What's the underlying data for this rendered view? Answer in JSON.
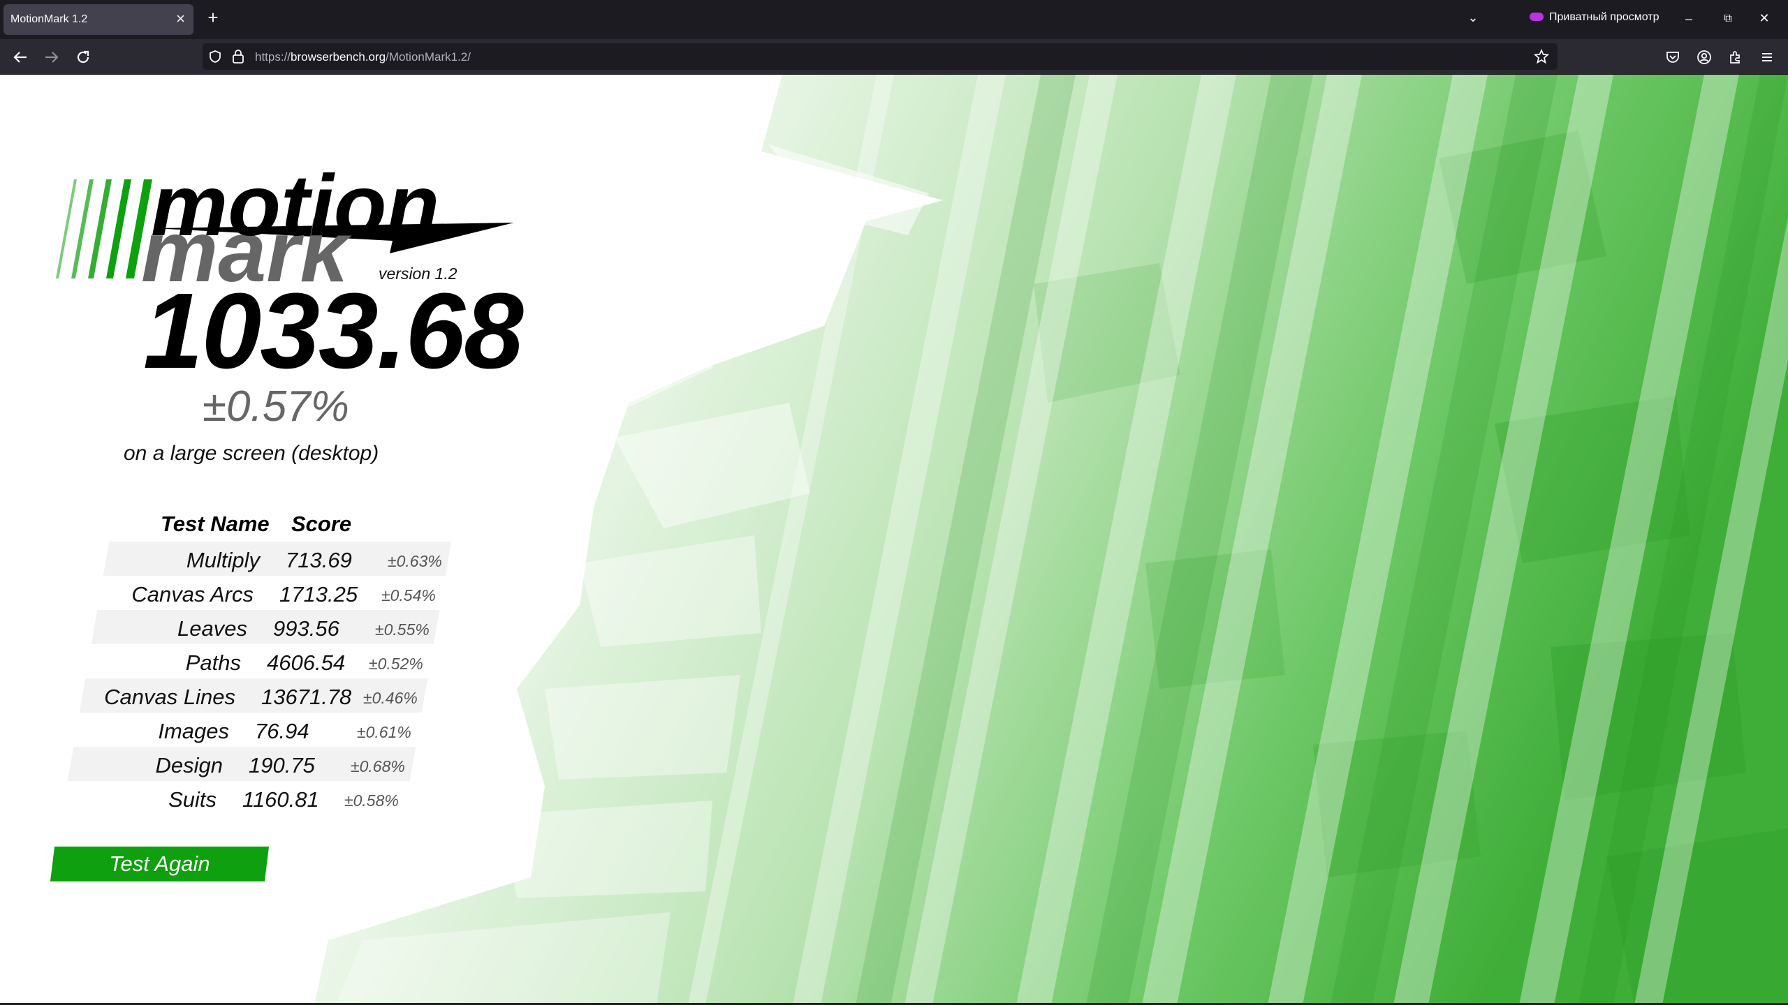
{
  "browser": {
    "tab": {
      "title": "MotionMark 1.2",
      "close_icon": "close-icon"
    },
    "new_tab_icon": "plus-icon",
    "tab_list_icon": "chevron-down-icon",
    "private_label": "Приватный просмотр",
    "window_controls": {
      "minimize": "–",
      "restore": "⧉",
      "close": "✕"
    },
    "url": {
      "scheme": "https://",
      "host": "browserbench.org",
      "path": "/MotionMark1.2/"
    }
  },
  "page": {
    "logo": {
      "word1": "motion",
      "word2": "mark",
      "version": "version 1.2"
    },
    "score": "1033.68",
    "confidence": "±0.57%",
    "environment": "on a large screen (desktop)",
    "table": {
      "headers": {
        "name": "Test Name",
        "score": "Score"
      },
      "rows": [
        {
          "name": "Multiply",
          "score": "713.69",
          "pct": "±0.63%"
        },
        {
          "name": "Canvas Arcs",
          "score": "1713.25",
          "pct": "±0.54%"
        },
        {
          "name": "Leaves",
          "score": "993.56",
          "pct": "±0.55%"
        },
        {
          "name": "Paths",
          "score": "4606.54",
          "pct": "±0.52%"
        },
        {
          "name": "Canvas Lines",
          "score": "13671.78",
          "pct": "±0.46%"
        },
        {
          "name": "Images",
          "score": "76.94",
          "pct": "±0.61%"
        },
        {
          "name": "Design",
          "score": "190.75",
          "pct": "±0.68%"
        },
        {
          "name": "Suits",
          "score": "1160.81",
          "pct": "±0.58%"
        }
      ]
    },
    "test_again_label": "Test Again",
    "colors": {
      "accent": "#0ea00e",
      "stripe_dark": "#2ea32a",
      "stripe_light": "#d6efd2"
    }
  }
}
